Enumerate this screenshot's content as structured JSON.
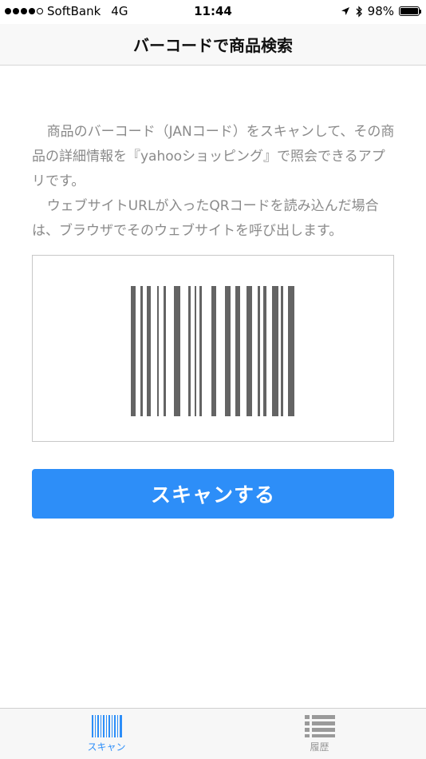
{
  "status_bar": {
    "carrier": "SoftBank",
    "network": "4G",
    "time": "11:44",
    "battery": "98%",
    "signal_bars_filled": 4,
    "signal_bars_total": 5
  },
  "nav": {
    "title": "バーコードで商品検索"
  },
  "description": {
    "paragraph_1": "商品のバーコード（JANコード）をスキャンして、その商品の詳細情報を『yahooショッピング』で照会できるアプリです。",
    "paragraph_2": "ウェブサイトURLが入ったQRコードを読み込んだ場合は、ブラウザでそのウェブサイトを呼び出します。"
  },
  "barcode": {
    "icon": "barcode-icon",
    "bar_color": "#646464"
  },
  "scan_button": {
    "label": "スキャンする",
    "color": "#2d8ef8"
  },
  "tab_bar": {
    "tabs": [
      {
        "label": "スキャン",
        "icon": "barcode-icon",
        "active": true
      },
      {
        "label": "履歴",
        "icon": "list-icon",
        "active": false
      }
    ]
  }
}
